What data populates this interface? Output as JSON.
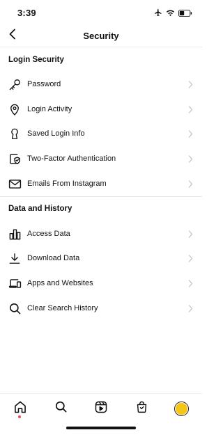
{
  "status_bar": {
    "time": "3:39",
    "icons": [
      "airplane-icon",
      "wifi-icon",
      "battery-icon"
    ]
  },
  "header": {
    "title": "Security",
    "back_icon": "chevron-left-icon"
  },
  "sections": [
    {
      "title": "Login Security",
      "items": [
        {
          "label": "Password",
          "icon": "key-icon"
        },
        {
          "label": "Login Activity",
          "icon": "location-pin-icon"
        },
        {
          "label": "Saved Login Info",
          "icon": "keyhole-icon"
        },
        {
          "label": "Two-Factor Authentication",
          "icon": "shield-check-icon"
        },
        {
          "label": "Emails From Instagram",
          "icon": "envelope-icon"
        }
      ]
    },
    {
      "title": "Data and History",
      "items": [
        {
          "label": "Access Data",
          "icon": "bar-chart-icon"
        },
        {
          "label": "Download Data",
          "icon": "download-icon"
        },
        {
          "label": "Apps and Websites",
          "icon": "devices-icon"
        },
        {
          "label": "Clear Search History",
          "icon": "search-icon"
        }
      ]
    }
  ],
  "tab_bar": {
    "tabs": [
      "home-icon",
      "search-icon",
      "reels-icon",
      "shop-icon",
      "profile-avatar"
    ],
    "notification_dot_color": "#ed4956"
  },
  "colors": {
    "text": "#111111",
    "chevron": "#c4c4c4",
    "divider": "#e6e6e6",
    "avatar_fill": "#f5c518"
  }
}
